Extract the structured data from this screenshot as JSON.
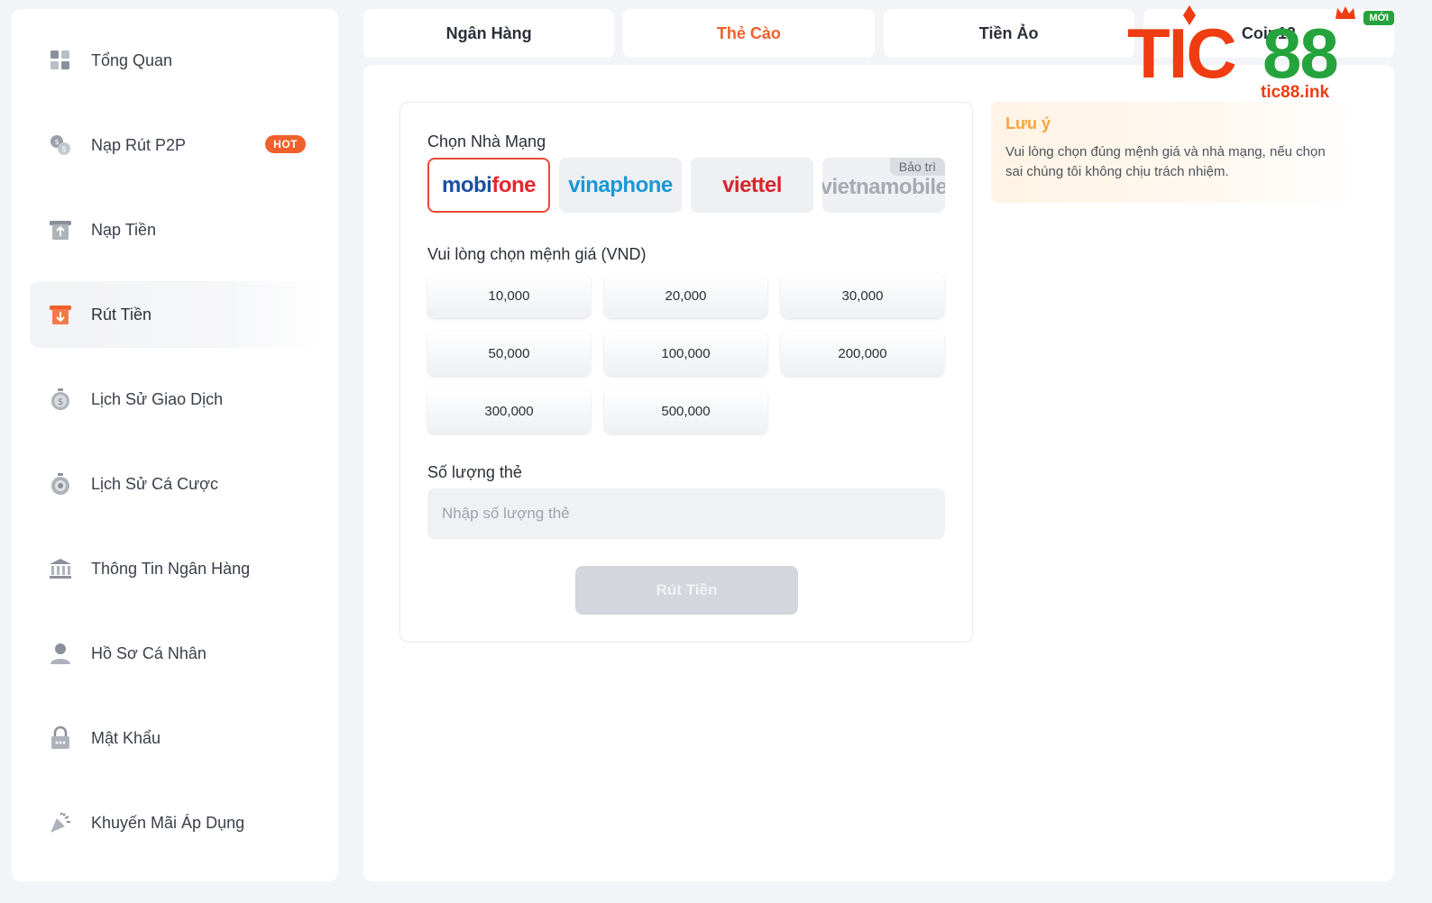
{
  "sidebar": {
    "items": [
      {
        "label": "Tổng Quan",
        "icon": "dashboard-icon"
      },
      {
        "label": "Nạp Rút P2P",
        "icon": "coins-exchange-icon",
        "badge": "HOT"
      },
      {
        "label": "Nạp Tiền",
        "icon": "deposit-icon"
      },
      {
        "label": "Rút Tiền",
        "icon": "withdraw-icon",
        "active": true
      },
      {
        "label": "Lịch Sử Giao Dịch",
        "icon": "transaction-history-icon"
      },
      {
        "label": "Lịch Sử Cá Cược",
        "icon": "bet-history-icon"
      },
      {
        "label": "Thông Tin Ngân Hàng",
        "icon": "bank-icon"
      },
      {
        "label": "Hồ Sơ Cá Nhân",
        "icon": "user-icon"
      },
      {
        "label": "Mật Khẩu",
        "icon": "lock-icon"
      },
      {
        "label": "Khuyến Mãi Áp Dụng",
        "icon": "promotion-icon"
      }
    ]
  },
  "tabs": [
    {
      "label": "Ngân Hàng"
    },
    {
      "label": "Thẻ Cào",
      "active": true
    },
    {
      "label": "Tiền Ảo"
    },
    {
      "label": "Coin12"
    }
  ],
  "form": {
    "carrier_label": "Chọn Nhà Mạng",
    "carriers": [
      {
        "name": "mobifone",
        "selected": true
      },
      {
        "name": "vinaphone"
      },
      {
        "name": "viettel"
      },
      {
        "name": "vietnamobile",
        "badge": "Bảo trì"
      }
    ],
    "denom_label": "Vui lòng chọn mệnh giá (VND)",
    "denominations": [
      "10,000",
      "20,000",
      "30,000",
      "50,000",
      "100,000",
      "200,000",
      "300,000",
      "500,000"
    ],
    "qty_label": "Số lượng thẻ",
    "qty_placeholder": "Nhập số lượng thẻ",
    "submit_label": "Rút Tiền"
  },
  "notice": {
    "title": "Lưu ý",
    "text": "Vui lòng chọn đúng mệnh giá và nhà mạng, nếu chọn sai chúng tôi không chịu trách nhiệm."
  },
  "brand": {
    "tic": "TIC",
    "num": "88",
    "url": "tic88.ink",
    "new_badge": "MỚI"
  },
  "colors": {
    "accent": "#f0602c",
    "brand_red": "#ef3c13",
    "brand_green": "#25a33c",
    "notice_title": "#f5a53a"
  }
}
